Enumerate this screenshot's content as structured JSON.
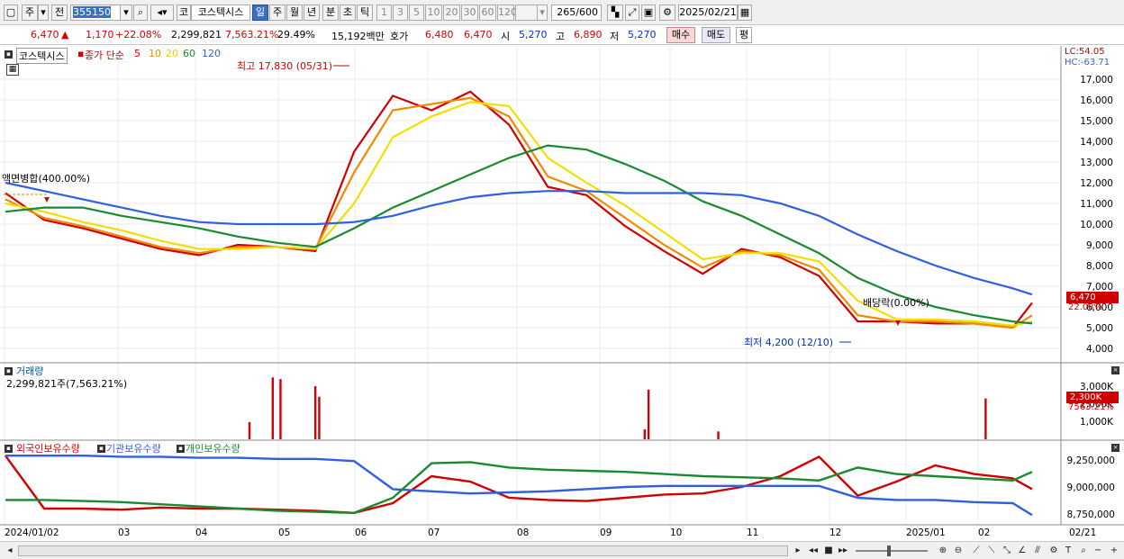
{
  "toolbar": {
    "period_button": "주",
    "exchange_button": "전",
    "code_value": "355150",
    "market_button": "코",
    "stock_name": "코스텍시스",
    "period_tabs": [
      "일",
      "주",
      "월",
      "년",
      "분",
      "초",
      "틱"
    ],
    "active_period": "일",
    "interval_buttons": [
      "1",
      "3",
      "5",
      "10",
      "20",
      "30",
      "60",
      "120"
    ],
    "count_current": "265",
    "count_total": "/600",
    "date_value": "2025/02/21"
  },
  "infobar": {
    "price": "6,470",
    "change": "1,170",
    "change_pct": "+22.08%",
    "volume": "2,299,821",
    "volume_ratio": "7,563.21%",
    "turnover": "29.49%",
    "trade_value": "15,192백만",
    "quote_label": "호가",
    "quote_ask": "6,480",
    "quote_bid": "6,470",
    "open_label": "시",
    "open_value": "5,270",
    "high_label": "고",
    "high_value": "6,890",
    "low_label": "저",
    "low_value": "5,270",
    "buy_button": "매수",
    "sell_button": "매도",
    "eval_button": "평"
  },
  "price_panel": {
    "stock_label": "코스텍시스",
    "ma_title": "종가 단순",
    "ma_periods": [
      "5",
      "10",
      "20",
      "60",
      "120"
    ],
    "ma_colors": [
      "#d00000",
      "#f08a00",
      "#f0e000",
      "#1a8a30",
      "#3060e0"
    ],
    "lc_label": "LC:54.05",
    "hc_label": "HC:-63.71",
    "high_annotation": "최고 17,830 (05/31)",
    "low_annotation": "최저 4,200 (12/10)",
    "split_annotation": "액면병합(400.00%)",
    "dividend_annotation": "배당락(0.00%)",
    "current_price_badge": "6,470",
    "current_pct_badge": "22.08%"
  },
  "volume_panel": {
    "title": "거래량",
    "summary": "2,299,821주(7,563.21%)",
    "current_badge": "2,300K",
    "current_pct": "7563.21%"
  },
  "holdings_panel": {
    "series_foreign": "외국인보유수량",
    "series_inst": "기관보유수량",
    "series_indiv": "개인보유수량"
  },
  "x_axis_labels": [
    "2024/01/02",
    "03",
    "04",
    "05",
    "06",
    "07",
    "08",
    "09",
    "10",
    "11",
    "12",
    "2025/01",
    "02",
    "02/21"
  ],
  "chart_data": [
    {
      "type": "line",
      "title": "",
      "y_axis_ticks": [
        "17,000",
        "16,000",
        "15,000",
        "14,000",
        "13,000",
        "12,000",
        "11,000",
        "10,000",
        "9,000",
        "8,000",
        "7,000",
        "6,000",
        "5,000",
        "4,000"
      ],
      "ylim": [
        3500,
        18500
      ],
      "x": [
        0,
        10,
        20,
        30,
        40,
        50,
        60,
        70,
        80,
        90,
        100,
        110,
        120,
        130,
        140,
        150,
        160,
        170,
        180,
        190,
        200,
        210,
        220,
        230,
        240,
        250,
        260,
        265
      ],
      "series": [
        {
          "name": "5",
          "values": [
            11500,
            10200,
            9800,
            9300,
            8800,
            8500,
            9000,
            8900,
            8700,
            13500,
            16200,
            15500,
            16400,
            14800,
            11800,
            11400,
            9900,
            8700,
            7600,
            8800,
            8400,
            7500,
            5300,
            5300,
            5200,
            5200,
            5000,
            6200
          ]
        },
        {
          "name": "10",
          "values": [
            11200,
            10300,
            9900,
            9400,
            8900,
            8600,
            8900,
            8900,
            8800,
            12500,
            15500,
            15800,
            16100,
            15200,
            12300,
            11600,
            10300,
            9000,
            7900,
            8700,
            8500,
            7800,
            5600,
            5300,
            5300,
            5200,
            5000,
            5600
          ]
        },
        {
          "name": "20",
          "values": [
            11000,
            10600,
            10100,
            9700,
            9200,
            8800,
            8800,
            8900,
            8800,
            11000,
            14200,
            15200,
            15900,
            15700,
            13200,
            12000,
            10900,
            9600,
            8300,
            8600,
            8600,
            8200,
            6300,
            5400,
            5400,
            5300,
            5100,
            5300
          ]
        },
        {
          "name": "60",
          "values": [
            10600,
            10800,
            10800,
            10400,
            10100,
            9800,
            9400,
            9100,
            8900,
            9800,
            10800,
            11600,
            12400,
            13200,
            13800,
            13600,
            12900,
            12100,
            11100,
            10400,
            9500,
            8600,
            7400,
            6600,
            6000,
            5600,
            5300,
            5200
          ]
        },
        {
          "name": "120",
          "values": [
            12000,
            11600,
            11200,
            10800,
            10400,
            10100,
            10000,
            10000,
            10000,
            10100,
            10400,
            10900,
            11300,
            11500,
            11600,
            11600,
            11500,
            11500,
            11500,
            11400,
            11000,
            10400,
            9500,
            8700,
            8000,
            7400,
            6900,
            6600
          ]
        }
      ]
    },
    {
      "type": "bar",
      "title": "거래량",
      "y_axis_ticks": [
        "3,000K",
        "2,000K",
        "1,000K"
      ],
      "ylim": [
        0,
        3500
      ],
      "x": [
        63,
        69,
        71,
        80,
        81,
        165,
        166,
        184,
        253
      ],
      "values": [
        950,
        3800,
        3400,
        3000,
        2400,
        540,
        2800,
        420,
        2300
      ]
    },
    {
      "type": "line",
      "title": "보유수량",
      "y_axis_ticks": [
        "9,250,000",
        "9,000,000",
        "8,750,000"
      ],
      "ylim": [
        8700000,
        9300000
      ],
      "x": [
        0,
        10,
        20,
        30,
        40,
        50,
        60,
        70,
        80,
        90,
        100,
        110,
        120,
        130,
        140,
        150,
        160,
        170,
        180,
        190,
        200,
        210,
        220,
        230,
        240,
        250,
        260,
        265
      ],
      "series": [
        {
          "name": "외국인보유수량",
          "values": [
            9290000,
            8800000,
            8800000,
            8790000,
            8810000,
            8800000,
            8800000,
            8790000,
            8780000,
            8760000,
            8850000,
            9100000,
            9050000,
            8900000,
            8880000,
            8870000,
            8900000,
            8930000,
            8940000,
            9000000,
            9100000,
            9280000,
            8920000,
            9050000,
            9200000,
            9120000,
            9080000,
            8980000
          ]
        },
        {
          "name": "기관보유수량",
          "values": [
            9290000,
            9290000,
            9290000,
            9280000,
            9280000,
            9270000,
            9270000,
            9260000,
            9260000,
            9240000,
            8980000,
            8960000,
            8940000,
            8950000,
            8960000,
            8980000,
            9000000,
            9010000,
            9010000,
            9010000,
            9010000,
            9010000,
            8900000,
            8880000,
            8880000,
            8860000,
            8850000,
            8740000
          ]
        },
        {
          "name": "개인보유수량",
          "values": [
            8880000,
            8880000,
            8870000,
            8860000,
            8840000,
            8820000,
            8800000,
            8780000,
            8770000,
            8760000,
            8900000,
            9220000,
            9230000,
            9180000,
            9160000,
            9150000,
            9140000,
            9120000,
            9100000,
            9090000,
            9080000,
            9060000,
            9180000,
            9120000,
            9100000,
            9080000,
            9060000,
            9140000
          ]
        }
      ]
    }
  ]
}
